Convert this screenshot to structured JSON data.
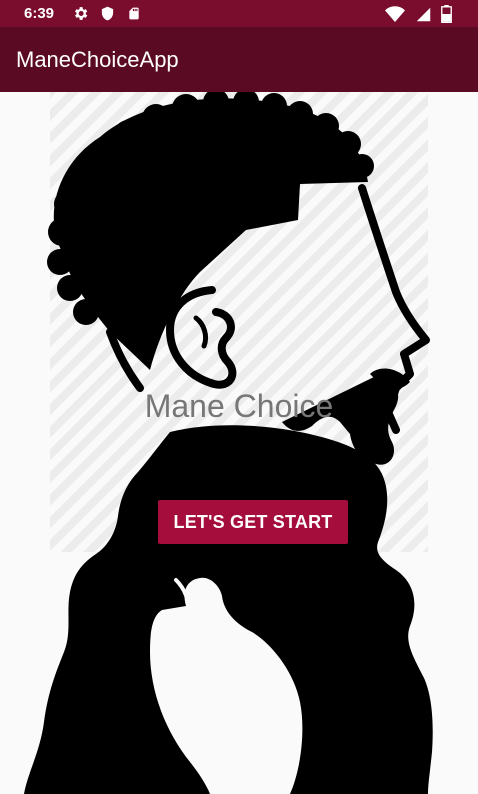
{
  "status_bar": {
    "time": "6:39"
  },
  "app_bar": {
    "title": "ManeChoiceApp"
  },
  "main": {
    "brand_title": "Mane Choice",
    "start_button_label": "LET'S GET START"
  },
  "icons": {
    "status_left": [
      "settings-icon",
      "shield-icon",
      "sd-card-icon"
    ],
    "status_right": [
      "wifi-icon",
      "cellular-signal-icon",
      "battery-icon"
    ]
  },
  "colors": {
    "status_bar": "#7a0c2e",
    "app_bar": "#5a0a22",
    "button": "#a50d3c",
    "brand_text": "#777777",
    "background": "#fafafa"
  }
}
